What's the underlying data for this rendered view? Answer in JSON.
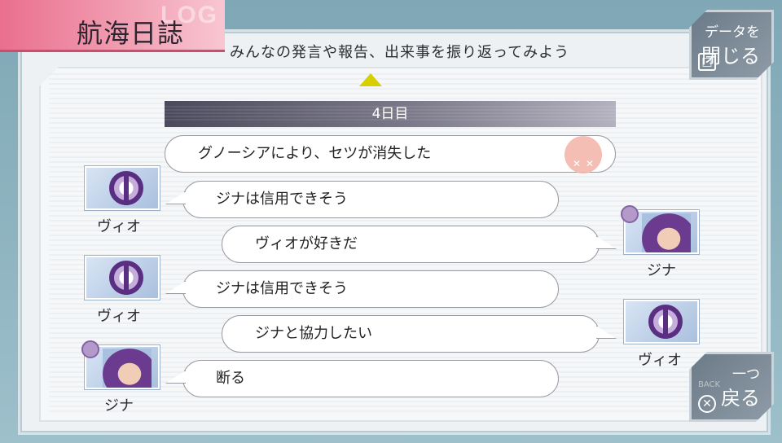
{
  "title": "航海日誌",
  "title_ghost": "LOG",
  "subtitle": "みんなの発言や報告、出来事を振り返ってみよう",
  "day_label": "4日目",
  "close_button": {
    "line1": "データを",
    "line2": "閉じる",
    "button_symbol": "□"
  },
  "back_button": {
    "line1": "一つ",
    "line2": "戻る",
    "button_symbol": "✕",
    "hint": "BACK"
  },
  "entries": [
    {
      "type": "event",
      "text": "グノーシアにより、セツが消失した",
      "icon": "skull-event-icon"
    },
    {
      "type": "message",
      "speaker": "ヴィオ",
      "side": "left",
      "avatar": "vio",
      "text": "ジナは信用できそう"
    },
    {
      "type": "message",
      "speaker": "ジナ",
      "side": "right",
      "avatar": "gina",
      "text": "ヴィオが好きだ"
    },
    {
      "type": "message",
      "speaker": "ヴィオ",
      "side": "left",
      "avatar": "vio",
      "text": "ジナは信用できそう"
    },
    {
      "type": "message",
      "speaker": "ヴィオ",
      "side": "right",
      "avatar": "vio",
      "text": "ジナと協力したい"
    },
    {
      "type": "message",
      "speaker": "ジナ",
      "side": "left",
      "avatar": "gina",
      "text": "断る"
    }
  ]
}
